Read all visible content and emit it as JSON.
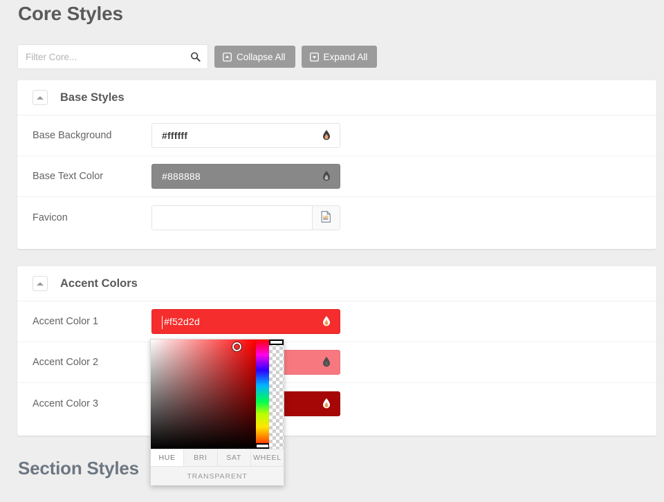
{
  "page": {
    "title": "Core Styles",
    "section_heading": "Section Styles"
  },
  "toolbar": {
    "filter_placeholder": "Filter Core...",
    "filter_value": "",
    "search_icon": "search-icon",
    "collapse_all_label": "Collapse All",
    "collapse_icon": "caret-square-up-icon",
    "expand_all_label": "Expand All",
    "expand_icon": "caret-square-down-icon"
  },
  "panels": [
    {
      "id": "base-styles",
      "title": "Base Styles",
      "toggle_icon": "caret-up-icon",
      "rows": [
        {
          "label": "Base Background",
          "type": "color",
          "value": "#ffffff",
          "swatch": "#ffffff",
          "text_color": "#3c3c3c",
          "icon": "tint-droplet-icon"
        },
        {
          "label": "Base Text Color",
          "type": "color",
          "value": "#888888",
          "swatch": "#888888",
          "text_color": "#ffffff",
          "icon": "tint-droplet-icon"
        },
        {
          "label": "Favicon",
          "type": "file",
          "value": "",
          "icon": "file-image-icon"
        }
      ]
    },
    {
      "id": "accent-colors",
      "title": "Accent Colors",
      "toggle_icon": "caret-up-icon",
      "rows": [
        {
          "label": "Accent Color 1",
          "type": "color",
          "value": "#f52d2d",
          "swatch": "#f52d2d",
          "text_color": "#ffffff",
          "icon": "tint-droplet-icon"
        },
        {
          "label": "Accent Color 2",
          "type": "color",
          "value": "",
          "swatch": "#f7797f",
          "text_color": "#ffffff",
          "icon": "tint-droplet-icon"
        },
        {
          "label": "Accent Color 3",
          "type": "color",
          "value": "",
          "swatch": "#a50707",
          "text_color": "#ffffff",
          "icon": "tint-droplet-icon"
        }
      ]
    }
  ],
  "color_picker": {
    "open_for": "Accent Color 1",
    "current_value": "#f52d2d",
    "hue_color": "#ff0000",
    "tabs": [
      {
        "label": "HUE",
        "active": true
      },
      {
        "label": "BRI",
        "active": false
      },
      {
        "label": "SAT",
        "active": false
      },
      {
        "label": "WHEEL",
        "active": false
      }
    ],
    "transparent_label": "TRANSPARENT"
  },
  "colors": {
    "page_background": "#eeeeee",
    "panel_background": "#ffffff",
    "button_gray": "#9b9b9b",
    "heading_gray": "#5a5a5a",
    "label_gray": "#636363"
  }
}
